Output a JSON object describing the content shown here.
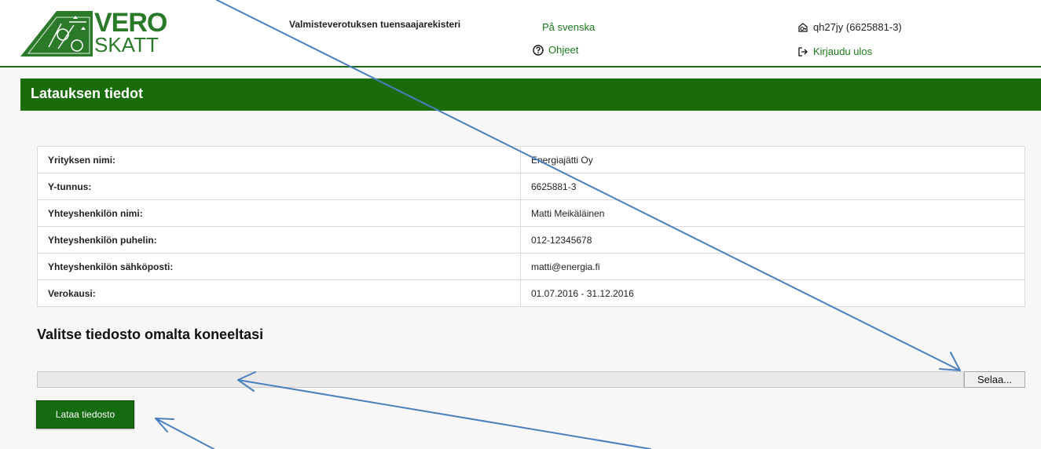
{
  "header": {
    "logo": {
      "line1": "VERO",
      "line2": "SKATT"
    },
    "app_title": "Valmisteverotuksen tuensaajarekisteri",
    "lang_link": "På svenska",
    "help_link": "Ohjeet",
    "user": "qh27jy (6625881-3)",
    "logout": "Kirjaudu ulos"
  },
  "page_title": "Latauksen tiedot",
  "info_rows": [
    {
      "label": "Yrityksen nimi:",
      "value": "Energiajätti Oy"
    },
    {
      "label": "Y-tunnus:",
      "value": "6625881-3"
    },
    {
      "label": "Yhteyshenkilön nimi:",
      "value": "Matti Meikäläinen"
    },
    {
      "label": "Yhteyshenkilön puhelin:",
      "value": "012-12345678"
    },
    {
      "label": "Yhteyshenkilön sähköposti:",
      "value": "matti@energia.fi"
    },
    {
      "label": "Verokausi:",
      "value": "01.07.2016 - 31.12.2016"
    }
  ],
  "upload": {
    "section_title": "Valitse tiedosto omalta koneeltasi",
    "file_value": "",
    "browse_label": "Selaa...",
    "upload_label": "Lataa tiedosto"
  },
  "colors": {
    "brand_green": "#1a6b0a",
    "link_green": "#1a7a1a",
    "annotation_blue": "#4a7fc0"
  },
  "icons": [
    "vero-emblem-icon",
    "help-circle-icon",
    "user-key-icon",
    "logout-icon"
  ]
}
